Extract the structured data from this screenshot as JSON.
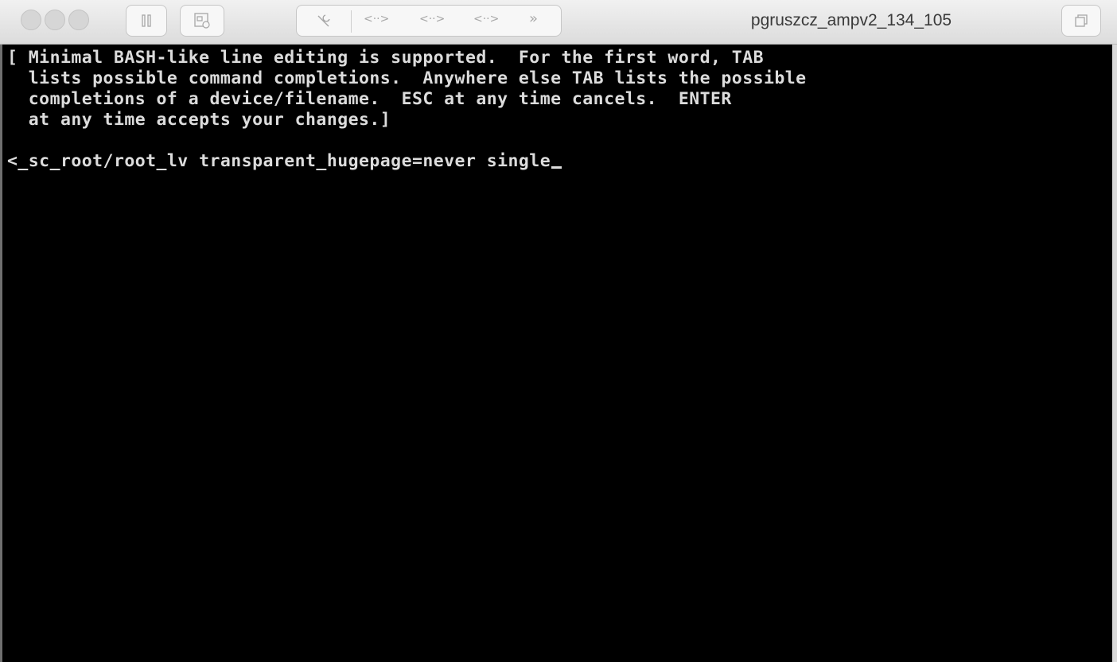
{
  "window": {
    "title": "pgruszcz_ampv2_134_105",
    "keys": [
      "<··>",
      "<··>",
      "<··>",
      "»"
    ]
  },
  "terminal": {
    "help_lines": [
      "[ Minimal BASH-like line editing is supported.  For the first word, TAB",
      "  lists possible command completions.  Anywhere else TAB lists the possible",
      "  completions of a device/filename.  ESC at any time cancels.  ENTER",
      "  at any time accepts your changes.]"
    ],
    "command_line": "<_sc_root/root_lv transparent_hugepage=never single"
  }
}
